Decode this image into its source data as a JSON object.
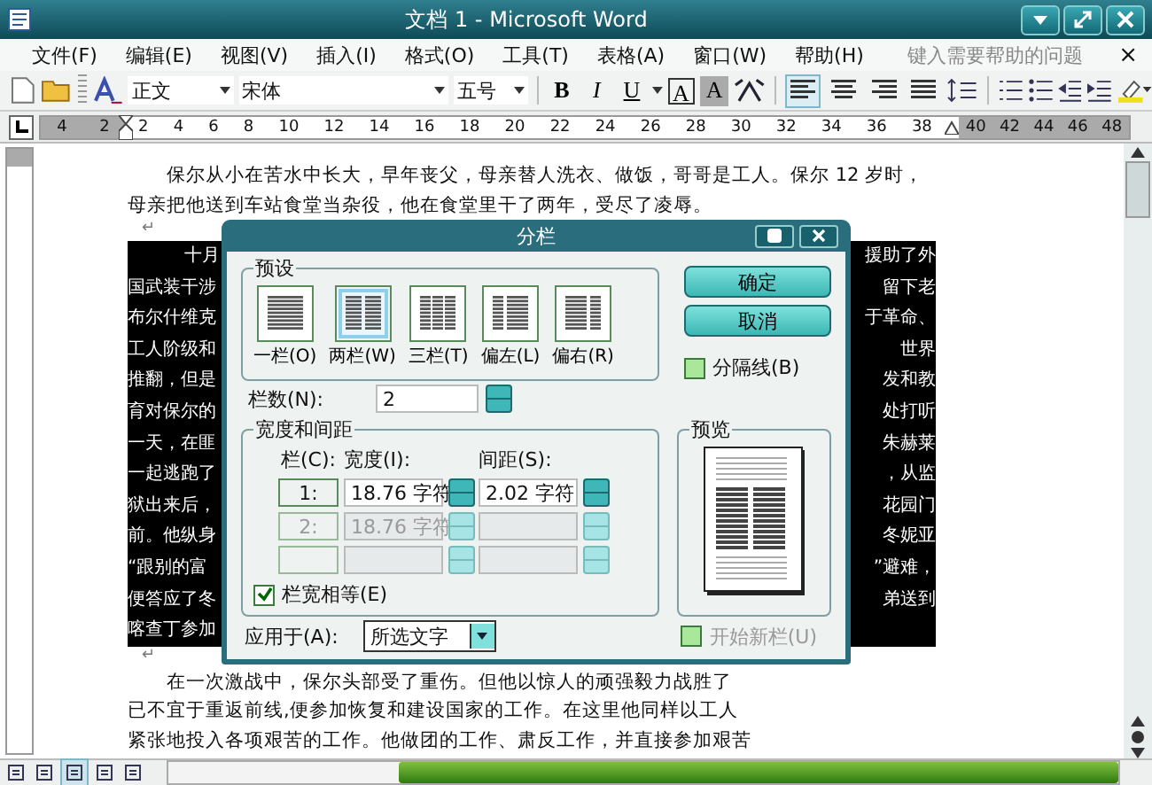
{
  "window": {
    "title": "文档 1 - Microsoft Word"
  },
  "menu": {
    "items": [
      "文件(F)",
      "编辑(E)",
      "视图(V)",
      "插入(I)",
      "格式(O)",
      "工具(T)",
      "表格(A)",
      "窗口(W)",
      "帮助(H)"
    ],
    "help_placeholder": "键入需要帮助的问题",
    "close": "×"
  },
  "toolbar": {
    "style": "正文",
    "font": "宋体",
    "size": "五号",
    "bold": "B",
    "italic": "I",
    "underline": "U",
    "boxed": "A",
    "shaded": "A",
    "alignments": [
      {
        "kind": "left",
        "selected": true
      },
      {
        "kind": "center",
        "selected": false
      },
      {
        "kind": "right",
        "selected": false
      },
      {
        "kind": "justify",
        "selected": false
      }
    ]
  },
  "ruler": {
    "left_ticks": [
      "4",
      "2"
    ],
    "ticks": [
      "2",
      "4",
      "6",
      "8",
      "10",
      "12",
      "14",
      "16",
      "18",
      "20",
      "22",
      "24",
      "26",
      "28",
      "30",
      "32",
      "34",
      "36",
      "38"
    ],
    "right_ticks": [
      "40",
      "42",
      "44",
      "46",
      "48"
    ]
  },
  "document": {
    "paragraph_1": [
      "保尔从小在苦水中长大，早年丧父，母亲替人洗衣、做饭，哥哥是工人。保尔 12 岁时，",
      "母亲把他送到车站食堂当杂役，他在食堂里干了两年，受尽了凌辱。"
    ],
    "selected_left": [
      "十月",
      "国武装干涉",
      "布尔什维克",
      "工人阶级和",
      "推翻，但是",
      "育对保尔的",
      "一天，在匪",
      "一起逃跑了",
      "狱出来后，",
      "前。他纵身",
      "“跟别的富",
      "便答应了冬",
      "喀查丁参加"
    ],
    "paragraph_marks": [
      "↵",
      "↵"
    ],
    "selected_right": [
      "援助了外",
      "留下老",
      "于革命、",
      "世界",
      "发和教",
      "处打听",
      "朱赫莱",
      "，从监",
      "花园门",
      "冬妮亚",
      "”避难，",
      "弟送到"
    ],
    "paragraph_2": [
      "在一次激战中，保尔头部受了重伤。但他以惊人的顽强毅力战胜了",
      "已不宜于重返前线,便参加恢复和建设国家的工作。在这里他同样以工人",
      "紧张地投入各项艰苦的工作。他做团的工作、肃反工作，并直接参加艰苦"
    ]
  },
  "dialog": {
    "title": "分栏",
    "presets_label": "预设",
    "presets": [
      {
        "kind": "one",
        "label": "一栏(O)",
        "selected": false
      },
      {
        "kind": "two",
        "label": "两栏(W)",
        "selected": true
      },
      {
        "kind": "three",
        "label": "三栏(T)",
        "selected": false
      },
      {
        "kind": "left",
        "label": "偏左(L)",
        "selected": false
      },
      {
        "kind": "right",
        "label": "偏右(R)",
        "selected": false
      }
    ],
    "ok": "确定",
    "cancel": "取消",
    "line_between": {
      "label": "分隔线(B)",
      "checked": false
    },
    "count_label": "栏数(N):",
    "count": "2",
    "width_group": "宽度和间距",
    "col_header": "栏(C):",
    "width_header": "宽度(I):",
    "spacing_header": "间距(S):",
    "rows": [
      {
        "number": "1:",
        "width": "18.76 字符",
        "spacing": "2.02 字符",
        "disabled": false
      },
      {
        "number": "2:",
        "width": "18.76 字符",
        "disabled": true
      },
      {
        "disabled": true
      }
    ],
    "equal_width": {
      "label": "栏宽相等(E)",
      "checked": true
    },
    "preview_label": "预览",
    "apply_label": "应用于(A):",
    "apply_value": "所选文字",
    "new_column": {
      "label": "开始新栏(U)",
      "checked": false,
      "disabled": true
    }
  }
}
